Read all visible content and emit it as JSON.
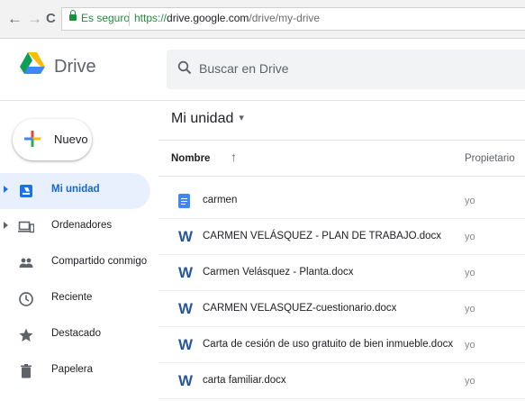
{
  "browser": {
    "back": "←",
    "forward": "→",
    "reload": "C",
    "secure_label": "Es seguro",
    "url_scheme": "https://",
    "url_host": "drive.google.com",
    "url_path": "/drive/my-drive"
  },
  "header": {
    "app_name": "Drive",
    "search_placeholder": "Buscar en Drive"
  },
  "sidebar": {
    "new_label": "Nuevo",
    "items": [
      {
        "label": "Mi unidad",
        "icon": "my-drive-icon",
        "active": true
      },
      {
        "label": "Ordenadores",
        "icon": "computer-icon",
        "active": false
      },
      {
        "label": "Compartido conmigo",
        "icon": "people-icon",
        "active": false
      },
      {
        "label": "Reciente",
        "icon": "clock-icon",
        "active": false
      },
      {
        "label": "Destacado",
        "icon": "star-icon",
        "active": false
      },
      {
        "label": "Papelera",
        "icon": "trash-icon",
        "active": false
      }
    ]
  },
  "main": {
    "breadcrumb": "Mi unidad",
    "breadcrumb_caret": "▾",
    "col_name": "Nombre",
    "sort_arrow": "↑",
    "col_owner": "Propietario",
    "files": [
      {
        "name": "carmen",
        "type": "gdoc",
        "owner": "yo"
      },
      {
        "name": "CARMEN VELÁSQUEZ - PLAN DE TRABAJO.docx",
        "type": "word",
        "owner": "yo"
      },
      {
        "name": "Carmen Velásquez - Planta.docx",
        "type": "word",
        "owner": "yo"
      },
      {
        "name": "CARMEN VELASQUEZ-cuestionario.docx",
        "type": "word",
        "owner": "yo"
      },
      {
        "name": "Carta de cesión de uso gratuito de bien inmueble.docx",
        "type": "word",
        "owner": "yo"
      },
      {
        "name": "carta familiar.docx",
        "type": "word",
        "owner": "yo"
      }
    ],
    "word_icon_letter": "W"
  },
  "colors": {
    "accent": "#1a73e8",
    "active_bg": "#e8f0fe",
    "word_blue": "#2a5699",
    "gdoc_blue": "#4285f4",
    "frame": "#b9dcea"
  }
}
